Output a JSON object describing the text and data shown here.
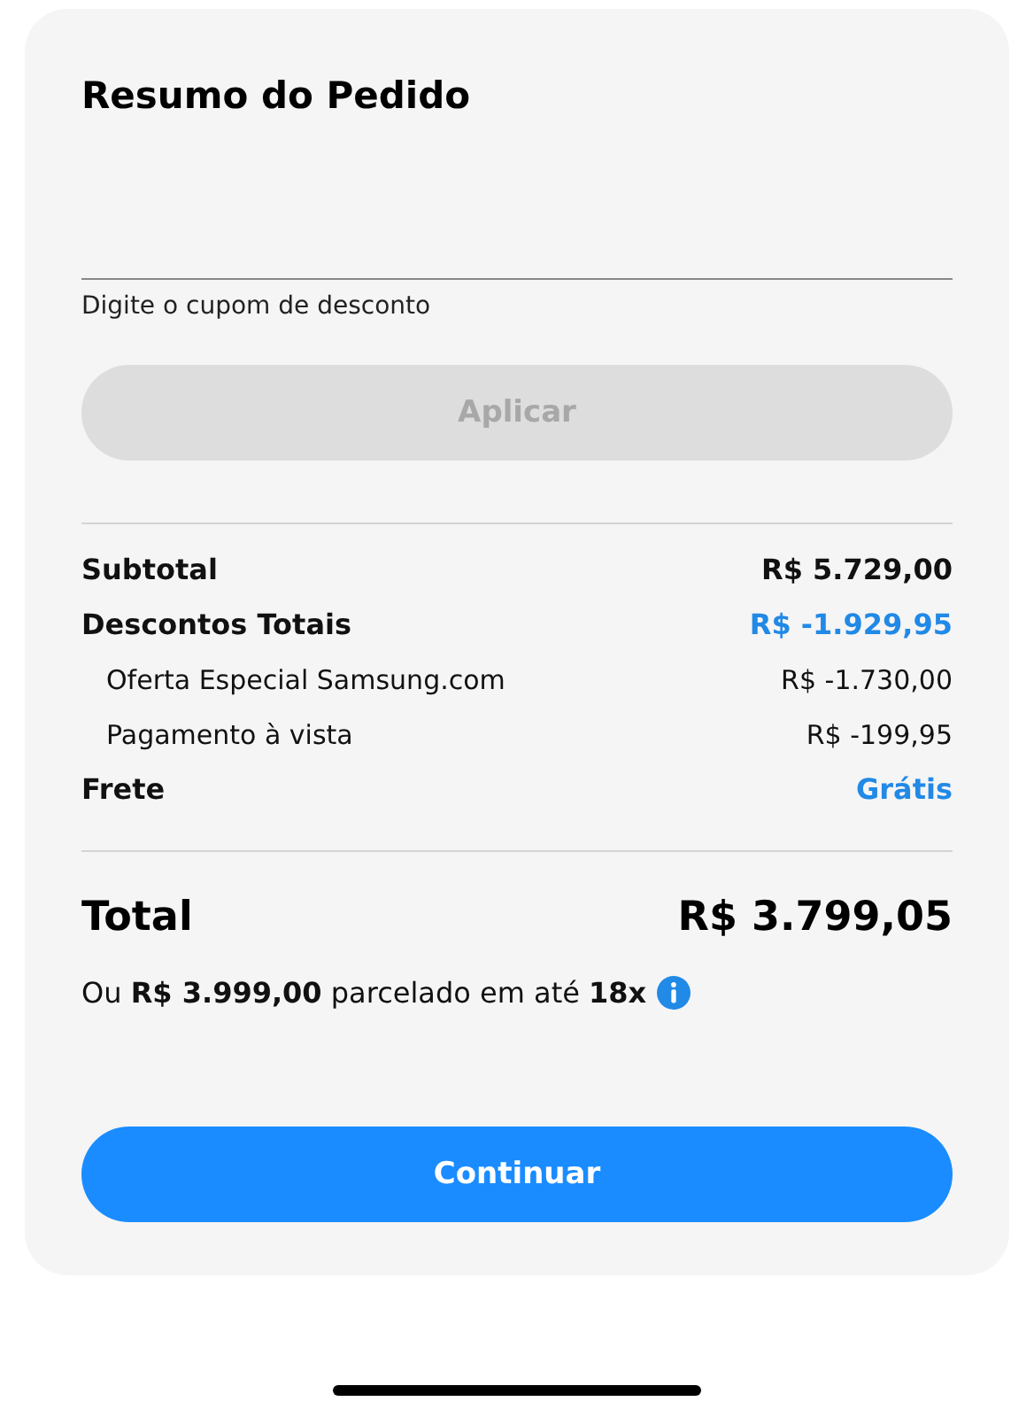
{
  "title": "Resumo do Pedido",
  "coupon": {
    "label": "Digite o cupom de desconto"
  },
  "apply_button": {
    "label": "Aplicar",
    "disabled": true
  },
  "rows": [
    {
      "kind": "main",
      "label": "Subtotal",
      "value": "R$ 5.729,00",
      "highlight": false
    },
    {
      "kind": "main",
      "label": "Descontos Totais",
      "value": "R$ -1.929,95",
      "highlight": true
    },
    {
      "kind": "sub",
      "label": "Oferta Especial Samsung.com",
      "value": "R$ -1.730,00",
      "highlight": false
    },
    {
      "kind": "sub",
      "label": "Pagamento à vista",
      "value": "R$ -199,95",
      "highlight": false
    },
    {
      "kind": "main",
      "label": "Frete",
      "value": "Grátis",
      "highlight": true
    }
  ],
  "total": {
    "label": "Total",
    "value": "R$ 3.799,05"
  },
  "installments": "Ou **R$ 3.999,00** parcelado em até **18x**",
  "continue_button": {
    "label": "Continuar",
    "disabled": false
  }
}
